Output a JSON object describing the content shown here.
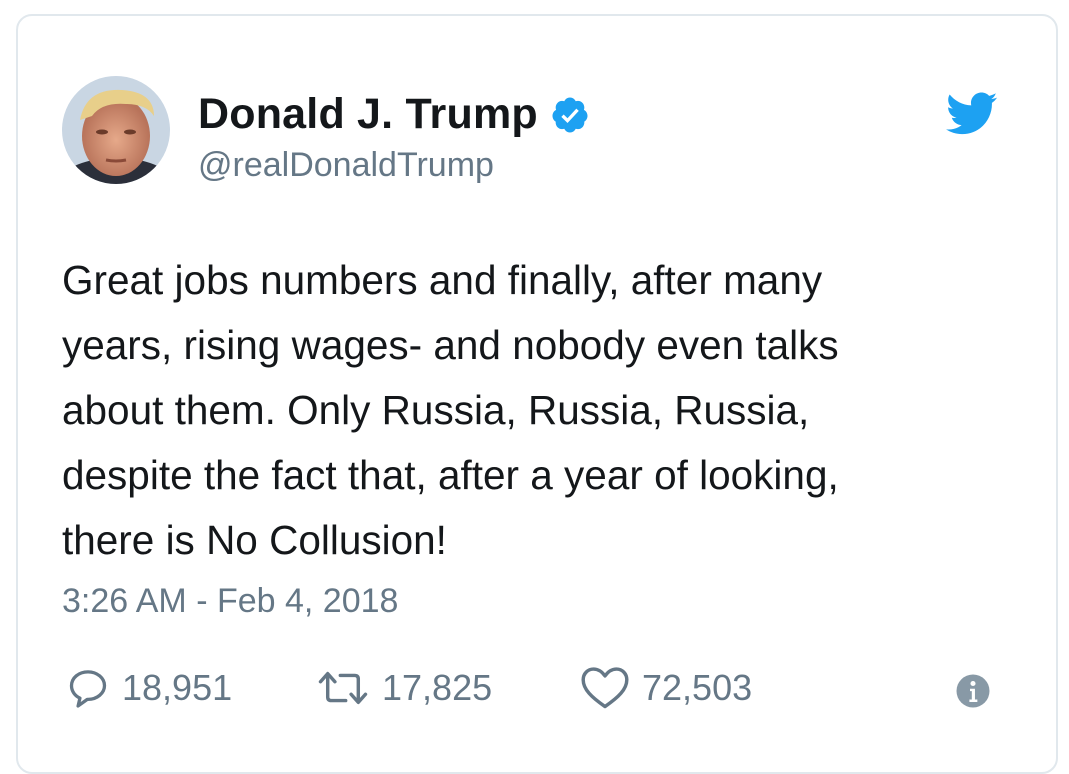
{
  "tweet": {
    "author": {
      "display_name": "Donald J. Trump",
      "handle": "@realDonaldTrump",
      "verified": true
    },
    "text_lines": [
      "Great jobs numbers and finally, after many",
      "years, rising wages- and nobody even talks",
      "about them. Only Russia, Russia, Russia,",
      "despite the fact that, after a year of looking,",
      "there is No Collusion!"
    ],
    "timestamp": "3:26 AM - Feb 4, 2018",
    "stats": {
      "replies": "18,951",
      "retweets": "17,825",
      "likes": "72,503"
    }
  },
  "icons": {
    "brand": "twitter-bird-icon",
    "verified": "verified-badge-icon",
    "reply": "reply-icon",
    "retweet": "retweet-icon",
    "like": "heart-icon",
    "info": "info-icon"
  },
  "colors": {
    "brand_blue": "#1da1f2",
    "text_primary": "#14171a",
    "text_secondary": "#657786",
    "border": "#e1e8ed"
  }
}
